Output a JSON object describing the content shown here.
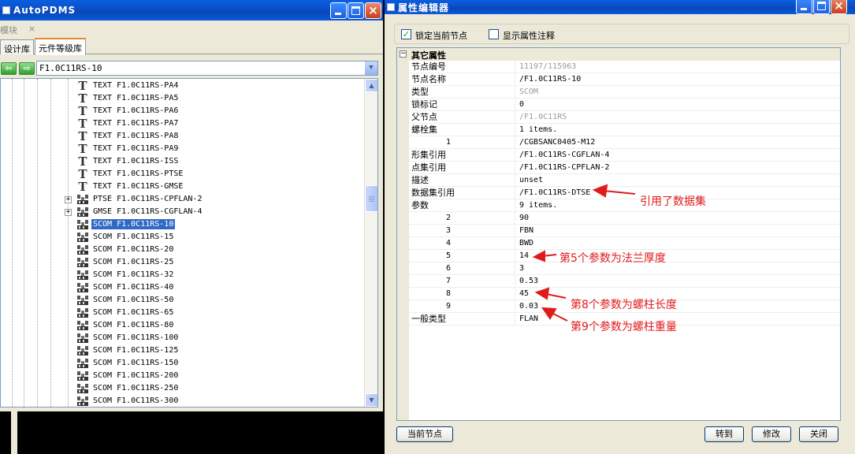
{
  "left_window": {
    "title": "AutoPDMS",
    "menu": [
      "模块",
      "×"
    ],
    "tabs": [
      {
        "label": "设计库",
        "active": false
      },
      {
        "label": "元件等级库",
        "active": true
      }
    ],
    "path_value": "F1.0C11RS-10",
    "tree_items": [
      {
        "icon": "text-t-icon",
        "label": "TEXT F1.0C11RS-PA4"
      },
      {
        "icon": "text-t-icon",
        "label": "TEXT F1.0C11RS-PA5"
      },
      {
        "icon": "text-t-icon",
        "label": "TEXT F1.0C11RS-PA6"
      },
      {
        "icon": "text-t-icon",
        "label": "TEXT F1.0C11RS-PA7"
      },
      {
        "icon": "text-t-icon",
        "label": "TEXT F1.0C11RS-PA8"
      },
      {
        "icon": "text-t-icon",
        "label": "TEXT F1.0C11RS-PA9"
      },
      {
        "icon": "text-t-icon",
        "label": "TEXT F1.0C11RS-ISS"
      },
      {
        "icon": "text-t-icon",
        "label": "TEXT F1.0C11RS-PTSE"
      },
      {
        "icon": "text-t-icon",
        "label": "TEXT F1.0C11RS-GMSE"
      },
      {
        "icon": "component-icon",
        "label": "PTSE F1.0C11RS-CPFLAN-2",
        "expandable": true
      },
      {
        "icon": "component-icon",
        "label": "GMSE F1.0C11RS-CGFLAN-4",
        "expandable": true
      },
      {
        "icon": "component-icon",
        "label": "SCOM F1.0C11RS-10",
        "selected": true
      },
      {
        "icon": "component-icon",
        "label": "SCOM F1.0C11RS-15"
      },
      {
        "icon": "component-icon",
        "label": "SCOM F1.0C11RS-20"
      },
      {
        "icon": "component-icon",
        "label": "SCOM F1.0C11RS-25"
      },
      {
        "icon": "component-icon",
        "label": "SCOM F1.0C11RS-32"
      },
      {
        "icon": "component-icon",
        "label": "SCOM F1.0C11RS-40"
      },
      {
        "icon": "component-icon",
        "label": "SCOM F1.0C11RS-50"
      },
      {
        "icon": "component-icon",
        "label": "SCOM F1.0C11RS-65"
      },
      {
        "icon": "component-icon",
        "label": "SCOM F1.0C11RS-80"
      },
      {
        "icon": "component-icon",
        "label": "SCOM F1.0C11RS-100"
      },
      {
        "icon": "component-icon",
        "label": "SCOM F1.0C11RS-125"
      },
      {
        "icon": "component-icon",
        "label": "SCOM F1.0C11RS-150"
      },
      {
        "icon": "component-icon",
        "label": "SCOM F1.0C11RS-200"
      },
      {
        "icon": "component-icon",
        "label": "SCOM F1.0C11RS-250"
      },
      {
        "icon": "component-icon",
        "label": "SCOM F1.0C11RS-300"
      }
    ]
  },
  "right_window": {
    "title": "属性编辑器",
    "lock_checkbox": {
      "label": "锁定当前节点",
      "checked": true
    },
    "comment_checkbox": {
      "label": "显示属性注释",
      "checked": false
    },
    "category": "其它属性",
    "rows": [
      {
        "key": "节点编号",
        "value": "11197/115963",
        "readonly": true
      },
      {
        "key": "节点名称",
        "value": "/F1.0C11RS-10"
      },
      {
        "key": "类型",
        "value": "SCOM",
        "readonly": true
      },
      {
        "key": "锁标记",
        "value": "0"
      },
      {
        "key": "父节点",
        "value": "/F1.0C11RS",
        "readonly": true
      },
      {
        "key": "螺栓集",
        "value": "1 items."
      },
      {
        "key": "1",
        "value": "/CGBSANC0405-M12",
        "indent": true
      },
      {
        "key": "形集引用",
        "value": "/F1.0C11RS-CGFLAN-4"
      },
      {
        "key": "点集引用",
        "value": "/F1.0C11RS-CPFLAN-2"
      },
      {
        "key": "描述",
        "value": "unset"
      },
      {
        "key": "数据集引用",
        "value": "/F1.0C11RS-DTSE"
      },
      {
        "key": "参数",
        "value": "9 items."
      },
      {
        "key": "2",
        "value": "90",
        "indent": true
      },
      {
        "key": "3",
        "value": "FBN",
        "indent": true
      },
      {
        "key": "4",
        "value": "BWD",
        "indent": true
      },
      {
        "key": "5",
        "value": "14",
        "indent": true
      },
      {
        "key": "6",
        "value": "3",
        "indent": true
      },
      {
        "key": "7",
        "value": "0.53",
        "indent": true
      },
      {
        "key": "8",
        "value": "45",
        "indent": true
      },
      {
        "key": "9",
        "value": "0.03",
        "indent": true
      },
      {
        "key": "一般类型",
        "value": "FLAN"
      }
    ],
    "annotations": [
      {
        "text": "引用了数据集"
      },
      {
        "text": "第5个参数为法兰厚度"
      },
      {
        "text": "第8个参数为螺柱长度"
      },
      {
        "text": "第9个参数为螺柱重量"
      }
    ],
    "buttons": {
      "current_node": "当前节点",
      "goto": "转到",
      "modify": "修改",
      "close": "关闭"
    }
  },
  "colors": {
    "selection": "#316AC5",
    "annotation_red": "#E01B1B",
    "titlebar_blue": "#0A5FE0"
  }
}
